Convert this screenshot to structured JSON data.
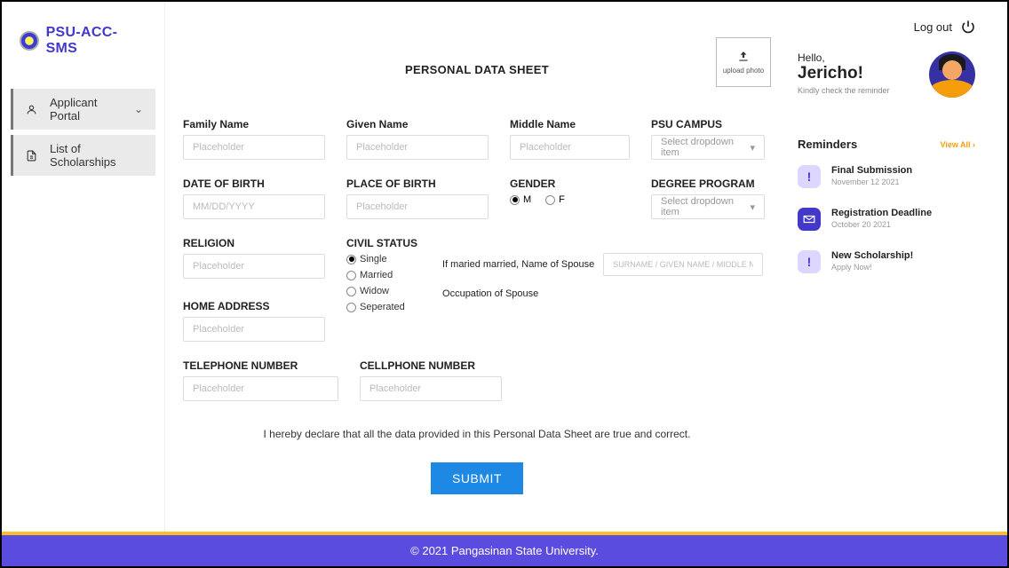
{
  "brand": {
    "name": "PSU-ACC-SMS"
  },
  "nav": {
    "items": [
      {
        "label": "Applicant Portal",
        "icon": "user-icon",
        "expandable": true
      },
      {
        "label": "List of Scholarships",
        "icon": "document-icon",
        "expandable": false
      }
    ]
  },
  "topbar": {
    "logout_label": "Log out"
  },
  "form": {
    "title": "PERSONAL DATA SHEET",
    "upload_label": "upload photo",
    "labels": {
      "family_name": "Family Name",
      "given_name": "Given Name",
      "middle_name": "Middle Name",
      "psu_campus": "PSU CAMPUS",
      "dob": "DATE OF BIRTH",
      "pob": "PLACE OF BIRTH",
      "gender": "GENDER",
      "degree_program": "DEGREE PROGRAM",
      "religion": "RELIGION",
      "civil_status": "CIVIL STATUS",
      "home_address": "HOME ADDRESS",
      "telephone": "TELEPHONE NUMBER",
      "cellphone": "CELLPHONE NUMBER"
    },
    "placeholders": {
      "generic": "Placeholder",
      "date": "MM/DD/YYYY",
      "select": "Select dropdown item",
      "spouse_name": "SURNAME / GIVEN NAME / MIDDLE NAME"
    },
    "gender_options": {
      "m": "M",
      "f": "F"
    },
    "civil_options": {
      "single": "Single",
      "married": "Married",
      "widow": "Widow",
      "separated": "Seperated"
    },
    "spouse_labels": {
      "name": "If maried married, Name of Spouse",
      "occupation": "Occupation of Spouse"
    },
    "declaration": "I hereby declare that all the data provided in this Personal Data Sheet are true and correct.",
    "submit_label": "SUBMIT"
  },
  "user": {
    "hello": "Hello,",
    "name": "Jericho!",
    "sub": "Kindly check the reminder"
  },
  "reminders": {
    "title": "Reminders",
    "view_all": "View All",
    "items": [
      {
        "title": "Final Submission",
        "sub": "November 12 2021",
        "icon": "!"
      },
      {
        "title": "Registration Deadline",
        "sub": "October 20 2021",
        "icon": "mail"
      },
      {
        "title": "New Scholarship!",
        "sub": "Apply Now!",
        "icon": "!"
      }
    ]
  },
  "footer": {
    "text": "© 2021 Pangasinan State University."
  }
}
